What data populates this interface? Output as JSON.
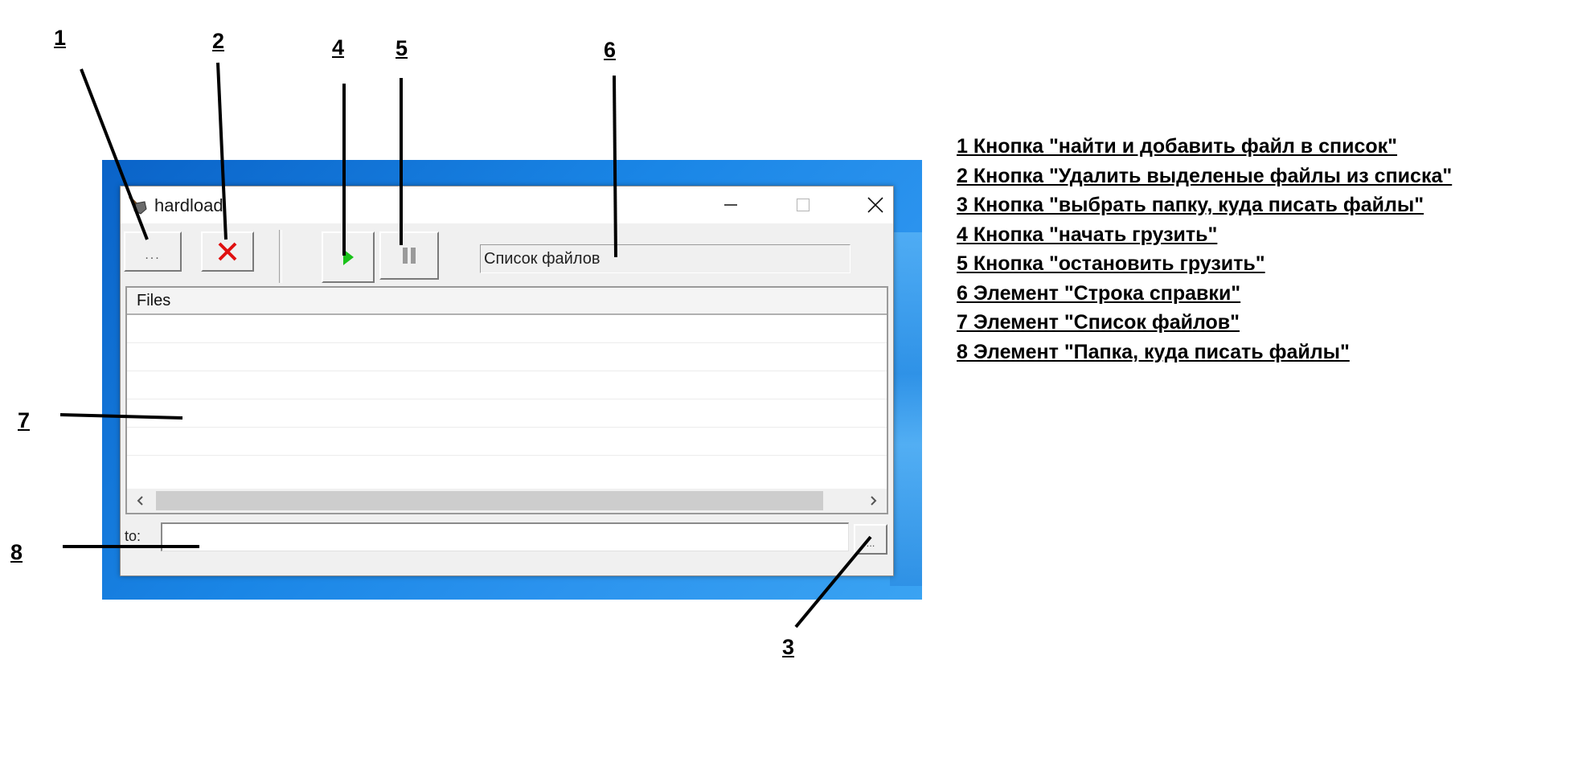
{
  "window": {
    "title": "hardload"
  },
  "toolbar": {
    "add_file_label": "...",
    "browse_folder_label": "..."
  },
  "help_line": {
    "text": "Список файлов"
  },
  "file_list": {
    "columns": [
      "Files"
    ],
    "rows": []
  },
  "destination": {
    "label": "to:",
    "value": ""
  },
  "callouts": [
    "1",
    "2",
    "3",
    "4",
    "5",
    "6",
    "7",
    "8"
  ],
  "legend": [
    "1 Кнопка \"найти и добавить файл в список\"",
    "2 Кнопка \"Удалить выделеные файлы из списка\"",
    "3 Кнопка \"выбрать папку, куда писать файлы\"",
    "4 Кнопка \"начать грузить\"",
    "5 Кнопка \"остановить грузить\"",
    "6 Элемент \"Строка справки\"",
    "7 Элемент \"Список файлов\"",
    "8 Элемент \"Папка, куда писать файлы\""
  ],
  "colors": {
    "desktop": "#1a86e6",
    "delete_icon": "#e01010",
    "start_icon": "#19c219",
    "pause_icon": "#9a9a9a"
  },
  "icons": {
    "app": "shovel-icon",
    "delete": "red-x-icon",
    "start": "green-play-icon",
    "stop": "pause-icon"
  }
}
